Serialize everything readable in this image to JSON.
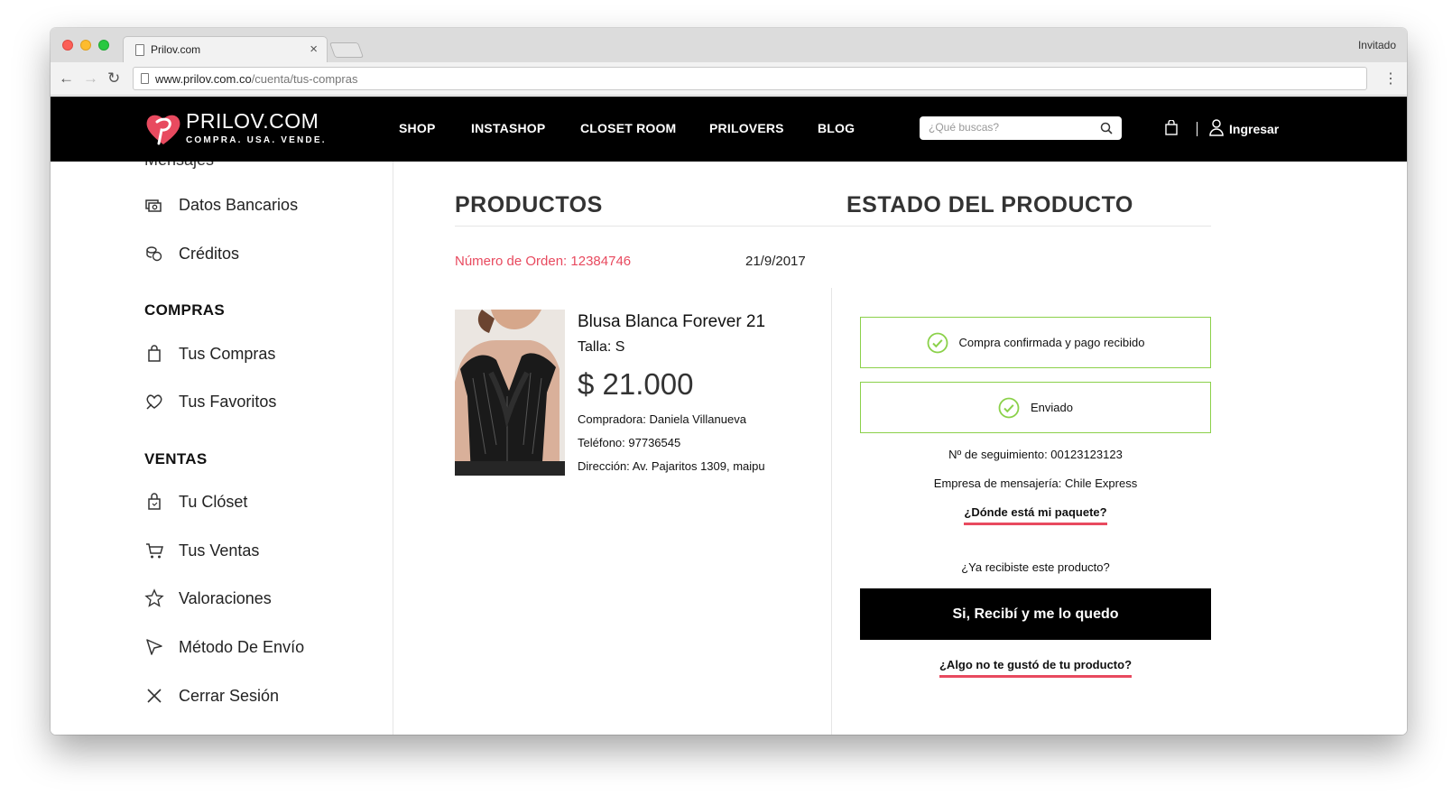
{
  "browser": {
    "tab_title": "Prilov.com",
    "tab_close": "×",
    "guest_label": "Invitado",
    "url_host": "www.prilov.com.co",
    "url_path": "/cuenta/tus-compras",
    "back": "←",
    "forward": "→",
    "reload": "↻",
    "menu": "⋮"
  },
  "header": {
    "logo_name": "PRILOV.COM",
    "logo_tagline": "COMPRA. USA. VENDE.",
    "nav": [
      "SHOP",
      "INSTASHOP",
      "CLOSET ROOM",
      "PRILOVERS",
      "BLOG"
    ],
    "search_placeholder": "¿Qué buscas?",
    "login": "Ingresar",
    "brand_color": "#e84a5f"
  },
  "sidebar": {
    "cut_item": "Mensajes",
    "items_top": [
      {
        "label": "Datos Bancarios",
        "icon": "bank-icon"
      },
      {
        "label": "Créditos",
        "icon": "coins-icon"
      }
    ],
    "compras_heading": "COMPRAS",
    "compras_items": [
      {
        "label": "Tus Compras",
        "icon": "shopping-bag-icon"
      },
      {
        "label": "Tus Favoritos",
        "icon": "heart-icon"
      }
    ],
    "ventas_heading": "VENTAS",
    "ventas_items": [
      {
        "label": "Tu Clóset",
        "icon": "closet-bag-icon"
      },
      {
        "label": "Tus Ventas",
        "icon": "cart-icon"
      },
      {
        "label": "Valoraciones",
        "icon": "star-icon"
      },
      {
        "label": "Método De Envío",
        "icon": "send-icon"
      },
      {
        "label": "Cerrar Sesión",
        "icon": "close-icon"
      }
    ]
  },
  "main": {
    "products_title": "PRODUCTOS",
    "status_title": "ESTADO DEL PRODUCTO",
    "order_number": "Número de Orden: 12384746",
    "order_date": "21/9/2017",
    "product": {
      "name": "Blusa Blanca Forever 21",
      "size": "Talla: S",
      "price": "$ 21.000",
      "buyer": "Compradora: Daniela Villanueva",
      "phone": "Teléfono: 97736545",
      "address": "Dirección: Av. Pajaritos 1309, maipu"
    },
    "status": {
      "confirmed": "Compra confirmada y pago recibido",
      "shipped": "Enviado",
      "tracking": "Nº de seguimiento: 00123123123",
      "courier": "Empresa de mensajería: Chile Express",
      "where_link": "¿Dónde está mi paquete?",
      "received_question": "¿Ya recibiste este producto?",
      "confirm_button": "Si, Recibí y me lo quedo",
      "dislike_link": "¿Algo no te gustó de tu producto?"
    }
  }
}
